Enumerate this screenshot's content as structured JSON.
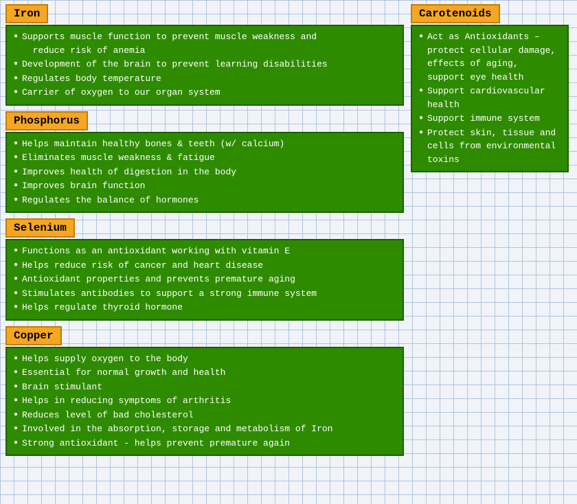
{
  "sections": {
    "iron": {
      "title": "Iron",
      "items": [
        "Supports muscle function to prevent muscle weakness and reduce risk of anemia",
        "Development of the brain to prevent learning disabilities",
        "Regulates body temperature",
        "Carrier of oxygen to our organ system"
      ]
    },
    "phosphorus": {
      "title": "Phosphorus",
      "items": [
        "Helps maintain healthy bones & teeth (w/ calcium)",
        "Eliminates muscle weakness & fatigue",
        "Improves health of digestion in the body",
        "Improves brain function",
        "Regulates the balance of hormones"
      ]
    },
    "selenium": {
      "title": "Selenium",
      "items": [
        "Functions as an antioxidant working with vitamin E",
        "Helps reduce risk of cancer and heart disease",
        "Antioxidant properties and prevents premature aging",
        "Stimulates antibodies to support a strong immune system",
        "Helps regulate thyroid hormone"
      ]
    },
    "copper": {
      "title": "Copper",
      "items": [
        "Helps supply oxygen to the body",
        "Essential for normal growth and health",
        "Brain stimulant",
        "Helps in reducing symptoms of arthritis",
        "Reduces level of bad cholesterol",
        "Involved in the absorption, storage and metabolism of Iron",
        "Strong antioxidant - helps prevent premature again"
      ]
    },
    "carotenoids": {
      "title": "Carotenoids",
      "items": [
        "Act as Antioxidants – protect cellular damage, effects of aging,  support eye health",
        "Support cardiovascular health",
        "Support immune system",
        "Protect skin, tissue and cells from environmental toxins"
      ]
    }
  }
}
